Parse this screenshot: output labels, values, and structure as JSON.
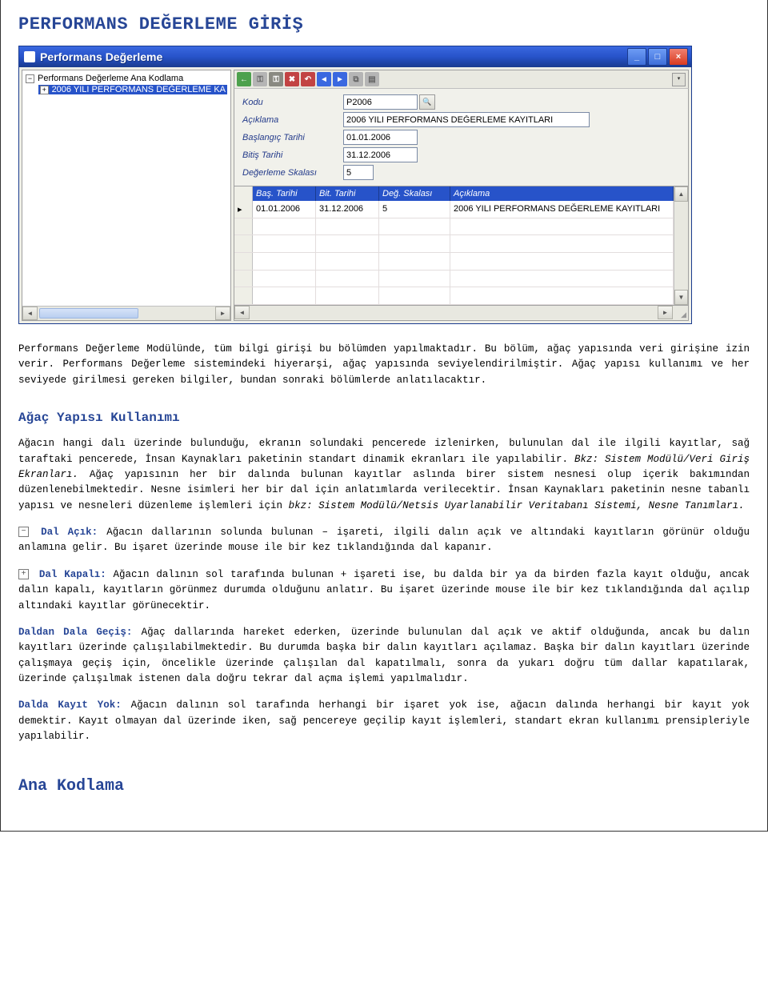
{
  "doc_title": "PERFORMANS DEĞERLEME GİRİŞ",
  "window": {
    "title": "Performans Değerleme",
    "tree": {
      "root_label": "Performans Değerleme Ana Kodlama",
      "child_label": "2006 YILI PERFORMANS DEĞERLEME KA"
    },
    "form": {
      "kodu_label": "Kodu",
      "kodu_value": "P2006",
      "aciklama_label": "Açıklama",
      "aciklama_value": "2006 YILI PERFORMANS DEĞERLEME KAYITLARI",
      "baslangic_label": "Başlangıç Tarihi",
      "baslangic_value": "01.01.2006",
      "bitis_label": "Bitiş Tarihi",
      "bitis_value": "31.12.2006",
      "skala_label": "Değerleme Skalası",
      "skala_value": "5"
    },
    "grid": {
      "headers": {
        "bas": "Baş. Tarihi",
        "bit": "Bit. Tarihi",
        "skala": "Değ. Skalası",
        "aciklama": "Açıklama"
      },
      "row": {
        "bas": "01.01.2006",
        "bit": "31.12.2006",
        "skala": "5",
        "aciklama": "2006 YILI PERFORMANS DEĞERLEME KAYITLARI"
      }
    }
  },
  "body": {
    "p1": "Performans Değerleme Modülünde, tüm bilgi girişi bu bölümden yapılmaktadır. Bu bölüm, ağaç yapısında veri girişine izin verir. Performans Değerleme sistemindeki hiyerarşi, ağaç yapısında seviyelendirilmiştir. Ağaç yapısı kullanımı ve her seviyede girilmesi gereken bilgiler, bundan sonraki bölümlerde anlatılacaktır.",
    "sec1_title": "Ağaç Yapısı Kullanımı",
    "p2a": "Ağacın hangi dalı üzerinde bulunduğu, ekranın solundaki pencerede izlenirken, bulunulan dal ile ilgili kayıtlar, sağ taraftaki pencerede, İnsan Kaynakları paketinin standart dinamik ekranları ile yapılabilir. ",
    "p2b_ref": "Bkz: Sistem Modülü/Veri Giriş Ekranları.",
    "p2c": " Ağaç yapısının her bir dalında bulunan kayıtlar aslında birer sistem nesnesi olup içerik bakımından düzenlenebilmektedir. Nesne isimleri her bir dal için anlatımlarda verilecektir. İnsan Kaynakları paketinin nesne tabanlı yapısı ve nesneleri düzenleme işlemleri için ",
    "p2d_ref": "bkz: Sistem Modülü/Netsis Uyarlanabilir Veritabanı Sistemi, Nesne Tanımları.",
    "dal_acik_label": "Dal Açık:",
    "dal_acik_text": " Ağacın dallarının solunda bulunan – işareti, ilgili dalın açık ve altındaki kayıtların görünür olduğu anlamına gelir. Bu işaret üzerinde mouse ile bir kez tıklandığında dal kapanır.",
    "dal_kapali_label": "Dal Kapalı:",
    "dal_kapali_text": " Ağacın dalının sol tarafında bulunan + işareti ise, bu dalda bir ya da birden fazla kayıt olduğu, ancak dalın kapalı, kayıtların görünmez durumda olduğunu anlatır. Bu işaret üzerinde mouse ile bir kez tıklandığında dal açılıp altındaki kayıtlar görünecektir.",
    "daldan_label": "Daldan Dala Geçiş:",
    "daldan_text": " Ağaç dallarında hareket ederken, üzerinde bulunulan dal açık ve aktif olduğunda, ancak bu dalın kayıtları üzerinde çalışılabilmektedir. Bu durumda başka bir dalın kayıtları açılamaz. Başka bir dalın kayıtları üzerinde çalışmaya geçiş için, öncelikle üzerinde çalışılan dal kapatılmalı, sonra da yukarı doğru tüm dallar kapatılarak, üzerinde çalışılmak istenen dala doğru tekrar dal açma işlemi yapılmalıdır.",
    "kayityok_label": "Dalda Kayıt Yok:",
    "kayityok_text": " Ağacın dalının sol tarafında herhangi bir işaret yok ise, ağacın dalında herhangi bir kayıt yok demektir. Kayıt olmayan dal üzerinde iken, sağ pencereye geçilip kayıt işlemleri, standart ekran kullanımı prensipleriyle yapılabilir.",
    "sec2_title": "Ana Kodlama"
  },
  "icons": {
    "minus": "−",
    "plus": "+"
  }
}
